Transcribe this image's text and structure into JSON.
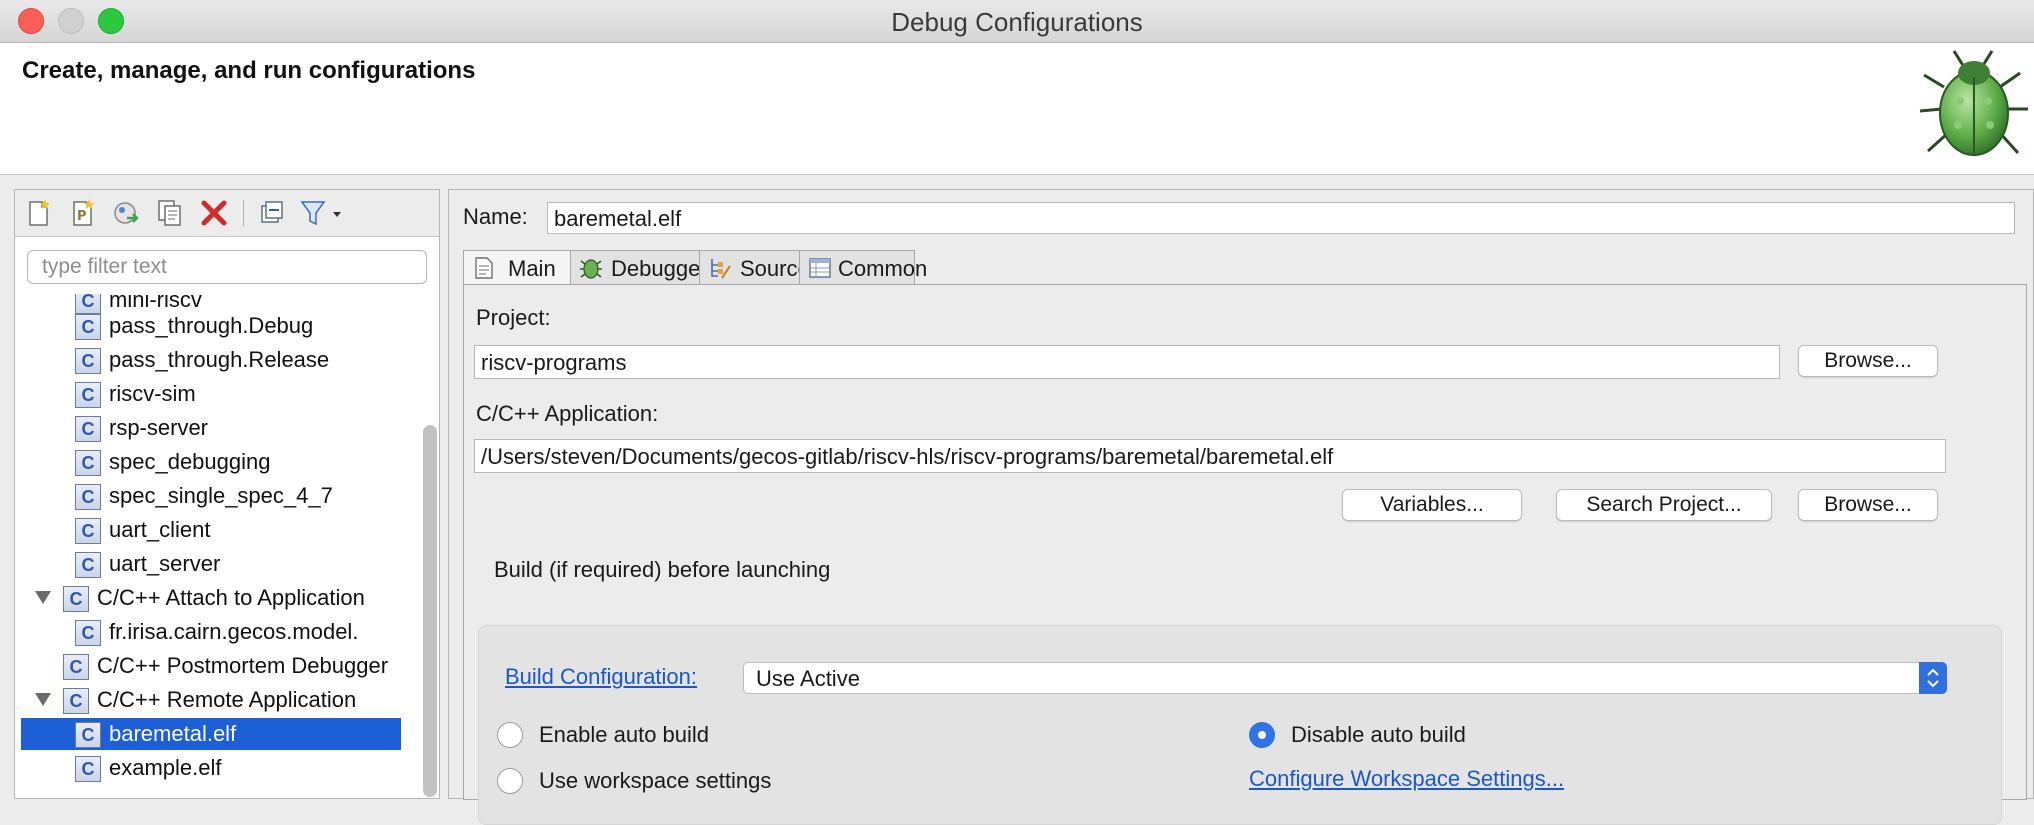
{
  "window": {
    "title": "Debug Configurations"
  },
  "banner": {
    "title": "Create, manage, and run configurations",
    "icon": "bug-icon"
  },
  "left": {
    "toolbar": [
      {
        "name": "new-configuration-icon"
      },
      {
        "name": "new-prototype-icon"
      },
      {
        "name": "export-configuration-icon"
      },
      {
        "name": "duplicate-icon"
      },
      {
        "name": "delete-icon"
      },
      {
        "name": "collapse-all-icon"
      },
      {
        "name": "filter-icon"
      }
    ],
    "filter_placeholder": "type filter text",
    "tree": [
      {
        "label": "mini-riscv",
        "level": 2
      },
      {
        "label": "pass_through.Debug",
        "level": 2
      },
      {
        "label": "pass_through.Release",
        "level": 2
      },
      {
        "label": "riscv-sim",
        "level": 2
      },
      {
        "label": "rsp-server",
        "level": 2
      },
      {
        "label": "spec_debugging",
        "level": 2
      },
      {
        "label": "spec_single_spec_4_7",
        "level": 2
      },
      {
        "label": "uart_client",
        "level": 2
      },
      {
        "label": "uart_server",
        "level": 2
      },
      {
        "label": "C/C++ Attach to Application",
        "level": 1,
        "expanded": true
      },
      {
        "label": "fr.irisa.cairn.gecos.model.",
        "level": 2
      },
      {
        "label": "C/C++ Postmortem Debugger",
        "level": 1
      },
      {
        "label": "C/C++ Remote Application",
        "level": 1,
        "expanded": true
      },
      {
        "label": "baremetal.elf",
        "level": 2,
        "selected": true
      },
      {
        "label": "example.elf",
        "level": 2
      }
    ]
  },
  "right": {
    "name_label": "Name:",
    "name_value": "baremetal.elf",
    "tabs": [
      {
        "label": "Main",
        "icon": "main-tab-icon",
        "active": true
      },
      {
        "label": "Debugger",
        "icon": "debugger-tab-icon"
      },
      {
        "label": "Source",
        "icon": "source-tab-icon"
      },
      {
        "label": "Common",
        "icon": "common-tab-icon"
      }
    ],
    "project_label": "Project:",
    "project_value": "riscv-programs",
    "browse_label": "Browse...",
    "app_label": "C/C++ Application:",
    "app_value": "/Users/steven/Documents/gecos-gitlab/riscv-hls/riscv-programs/baremetal/baremetal.elf",
    "variables_label": "Variables...",
    "search_project_label": "Search Project...",
    "browse2_label": "Browse...",
    "build_group_title": "Build (if required) before launching",
    "build_config_link": "Build Configuration:",
    "build_config_value": "Use Active",
    "enable_auto_build": "Enable auto build",
    "disable_auto_build": "Disable auto build",
    "use_workspace": "Use workspace settings",
    "configure_workspace_link": "Configure Workspace Settings..."
  },
  "colors": {
    "selection": "#1c5fd6",
    "link": "#1b58c7"
  }
}
